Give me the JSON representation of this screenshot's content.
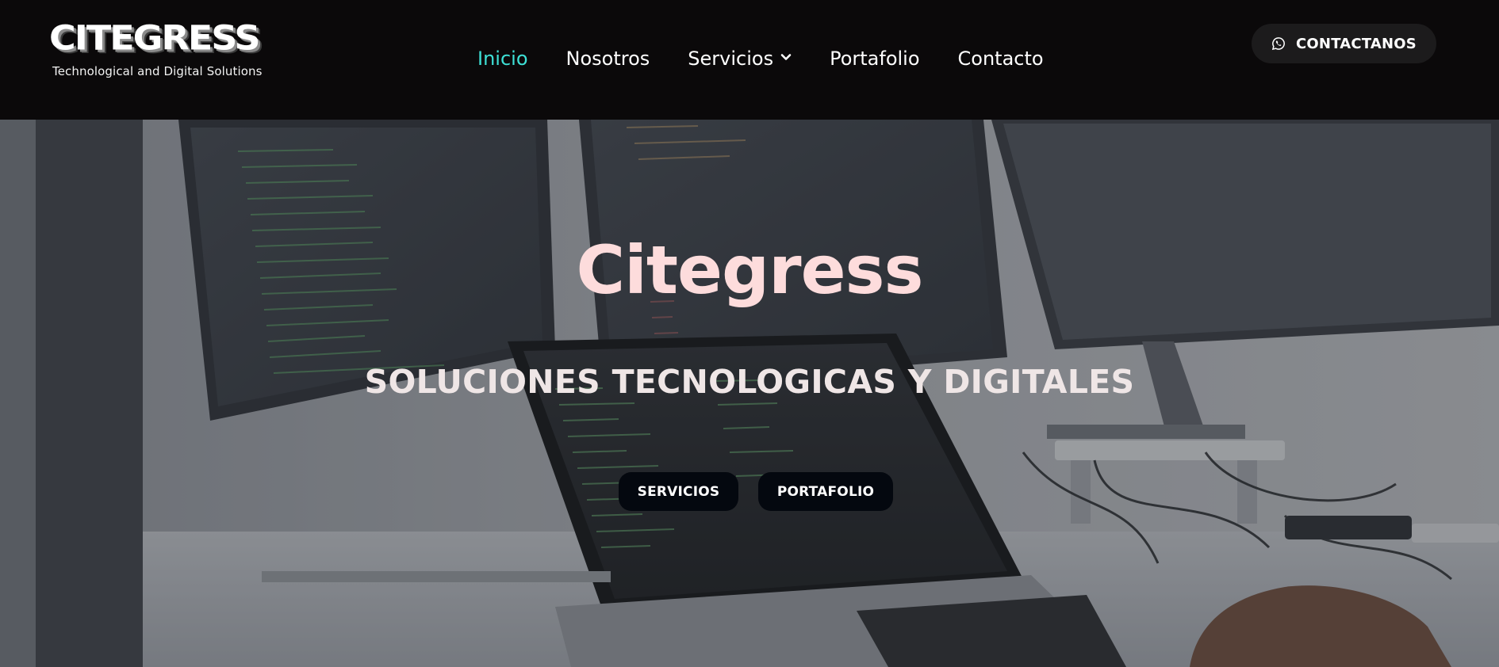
{
  "brand": {
    "name": "CITEGRESS",
    "tagline": "Technological and Digital Solutions"
  },
  "nav": {
    "items": [
      {
        "label": "Inicio",
        "active": true
      },
      {
        "label": "Nosotros",
        "active": false
      },
      {
        "label": "Servicios",
        "active": false,
        "has_dropdown": true
      },
      {
        "label": "Portafolio",
        "active": false
      },
      {
        "label": "Contacto",
        "active": false
      }
    ]
  },
  "cta": {
    "label": "CONTACTANOS",
    "icon": "whatsapp-icon"
  },
  "hero": {
    "title": "Citegress",
    "subtitle": "SOLUCIONES TECNOLOGICAS Y DIGITALES",
    "buttons": {
      "services": "SERVICIOS",
      "portfolio": "PORTAFOLIO"
    }
  },
  "colors": {
    "header_bg": "#0b090a",
    "nav_active": "#3ee0d6",
    "hero_title": "#fddcdc",
    "button_bg": "#04080f"
  }
}
